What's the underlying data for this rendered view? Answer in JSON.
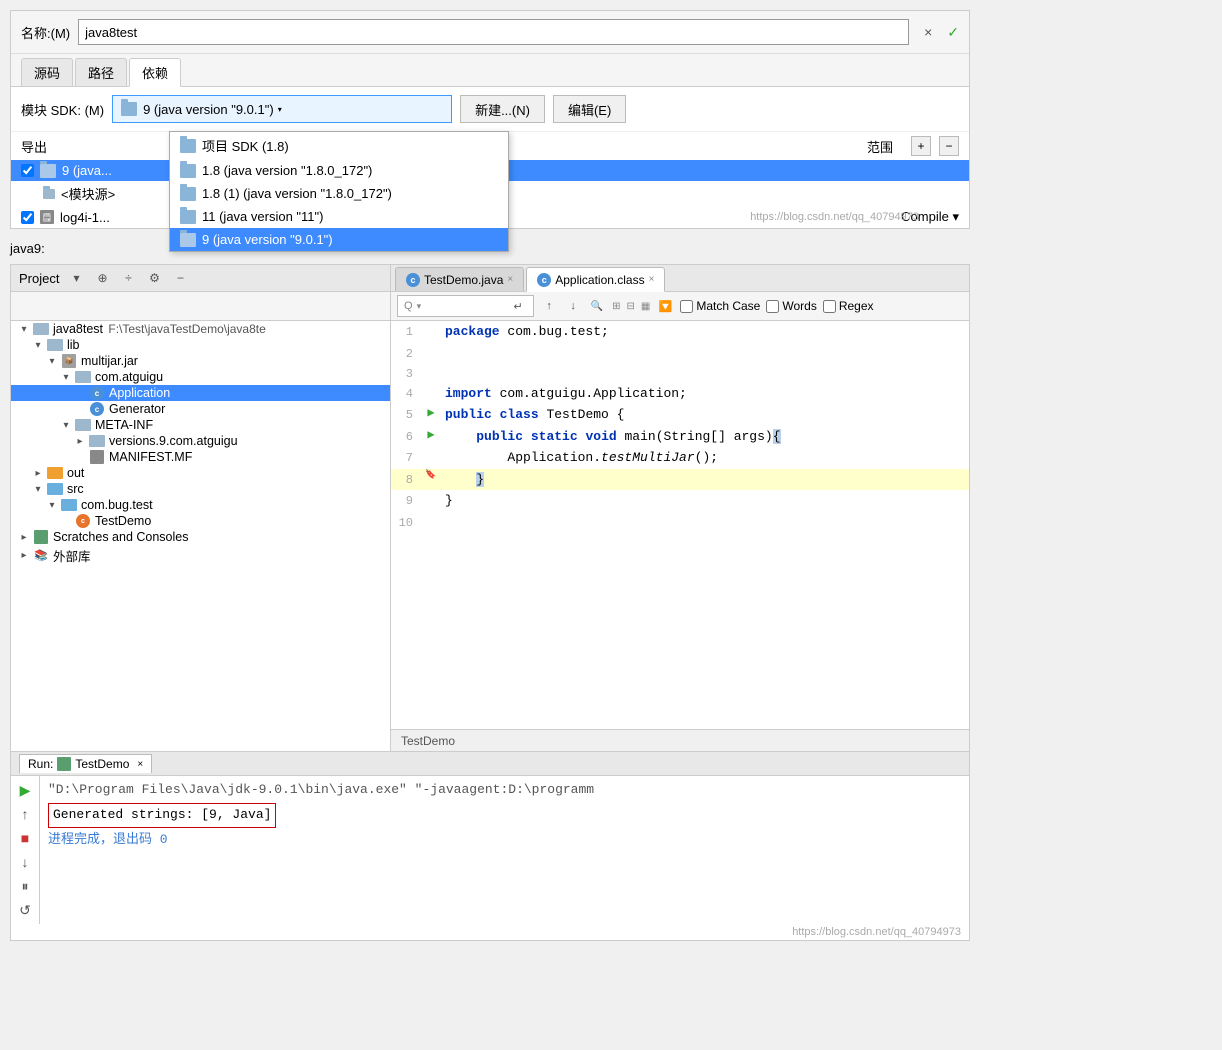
{
  "dialog": {
    "name_label": "名称:(M)",
    "name_value": "java8test",
    "close_btn": "×",
    "tabs": [
      "源码",
      "路径",
      "依赖"
    ],
    "active_tab": "依赖",
    "sdk_label": "模块 SDK: (M)",
    "sdk_selected": "9 (java version \"9.0.1\")",
    "new_btn": "新建...(N)",
    "edit_btn": "编辑(E)",
    "export_label": "导出",
    "scope_label": "范围",
    "plus_btn": "+",
    "minus_btn": "−",
    "dropdown_items": [
      {
        "label": "项目 SDK (1.8)",
        "selected": false
      },
      {
        "label": "1.8 (java version \"1.8.0_172\")",
        "selected": false
      },
      {
        "label": "1.8 (1) (java version \"1.8.0_172\")",
        "selected": false
      },
      {
        "label": "11 (java version \"11\")",
        "selected": false
      },
      {
        "label": "9 (java version \"9.0.1\")",
        "selected": true
      }
    ],
    "lib_rows": [
      {
        "icon": "folder",
        "name": "9 (java",
        "selected": false
      },
      {
        "icon": "module",
        "name": "<模块源>",
        "selected": false
      },
      {
        "name": "log4i-1...",
        "scope": "Compile",
        "selected": false
      }
    ],
    "watermark": "https://blog.csdn.net/qq_40794973"
  },
  "java9_label": "java9:",
  "ide": {
    "project_title": "Project",
    "header_icons": [
      "⊕",
      "÷",
      "⚙",
      "−"
    ],
    "editor_tabs": [
      {
        "label": "TestDemo.java",
        "active": false,
        "icon": "c"
      },
      {
        "label": "Application.class",
        "active": true,
        "icon": "c"
      }
    ],
    "search": {
      "placeholder": "",
      "match_case_label": "Match Case",
      "words_label": "Words",
      "regex_label": "Regex"
    },
    "project_tree": [
      {
        "indent": 0,
        "type": "arrow-expanded",
        "icon": "project",
        "label": "java8test",
        "path": "F:\\Test\\javaTestDemo\\java8te",
        "level": 0
      },
      {
        "indent": 1,
        "type": "arrow-expanded",
        "icon": "folder-gray",
        "label": "lib",
        "level": 1
      },
      {
        "indent": 2,
        "type": "arrow-expanded",
        "icon": "jar",
        "label": "multijar.jar",
        "level": 2
      },
      {
        "indent": 3,
        "type": "arrow-expanded",
        "icon": "folder-gray",
        "label": "com.atguigu",
        "level": 3
      },
      {
        "indent": 4,
        "type": "leaf",
        "icon": "class",
        "label": "Application",
        "level": 4
      },
      {
        "indent": 4,
        "type": "leaf",
        "icon": "class",
        "label": "Generator",
        "level": 4
      },
      {
        "indent": 3,
        "type": "arrow-expanded",
        "icon": "folder-gray",
        "label": "META-INF",
        "level": 3
      },
      {
        "indent": 4,
        "type": "arrow-collapsed",
        "icon": "folder-gray",
        "label": "versions.9.com.atguigu",
        "level": 4
      },
      {
        "indent": 4,
        "type": "leaf",
        "icon": "manifest",
        "label": "MANIFEST.MF",
        "level": 4
      },
      {
        "indent": 1,
        "type": "arrow-collapsed",
        "icon": "folder-orange",
        "label": "out",
        "level": 1
      },
      {
        "indent": 1,
        "type": "arrow-expanded",
        "icon": "folder-blue",
        "label": "src",
        "level": 1
      },
      {
        "indent": 2,
        "type": "arrow-expanded",
        "icon": "folder-blue",
        "label": "com.bug.test",
        "level": 2
      },
      {
        "indent": 3,
        "type": "leaf",
        "icon": "java",
        "label": "TestDemo",
        "level": 3
      },
      {
        "indent": 0,
        "type": "arrow-collapsed",
        "icon": "scratches",
        "label": "Scratches and Consoles",
        "level": 0
      },
      {
        "indent": 0,
        "type": "arrow-collapsed",
        "icon": "lib-icon",
        "label": "外部库",
        "level": 0
      }
    ],
    "code_lines": [
      {
        "num": 1,
        "content": "package com.bug.test;",
        "tokens": [
          {
            "type": "kw-blue",
            "text": "package"
          },
          {
            "type": "normal",
            "text": " com.bug.test;"
          }
        ]
      },
      {
        "num": 2,
        "content": ""
      },
      {
        "num": 3,
        "content": ""
      },
      {
        "num": 4,
        "content": "import com.atguigu.Application;",
        "tokens": [
          {
            "type": "kw-blue",
            "text": "import"
          },
          {
            "type": "normal",
            "text": " com.atguigu.Application;"
          }
        ]
      },
      {
        "num": 5,
        "content": "public class TestDemo {",
        "tokens": [
          {
            "type": "kw-blue",
            "text": "public"
          },
          {
            "type": "normal",
            "text": " "
          },
          {
            "type": "kw-blue",
            "text": "class"
          },
          {
            "type": "normal",
            "text": " TestDemo {"
          }
        ],
        "run_arrow": true
      },
      {
        "num": 6,
        "content": "    public static void main(String[] args){",
        "tokens": [
          {
            "type": "kw-blue",
            "text": "    public"
          },
          {
            "type": "normal",
            "text": " "
          },
          {
            "type": "kw-blue",
            "text": "static"
          },
          {
            "type": "normal",
            "text": " "
          },
          {
            "type": "kw-blue",
            "text": "void"
          },
          {
            "type": "normal",
            "text": " main(String[] args){"
          }
        ],
        "run_arrow": true,
        "has_bracket_highlight": true
      },
      {
        "num": 7,
        "content": "        Application.testMultiJar();",
        "tokens": [
          {
            "type": "normal",
            "text": "        Application."
          },
          {
            "type": "method",
            "text": "testMultiJar"
          },
          {
            "type": "normal",
            "text": "();"
          }
        ]
      },
      {
        "num": 8,
        "content": "    }",
        "tokens": [
          {
            "type": "normal",
            "text": "    }"
          }
        ],
        "highlighted": true
      },
      {
        "num": 9,
        "content": "}",
        "tokens": [
          {
            "type": "normal",
            "text": "}"
          }
        ]
      },
      {
        "num": 10,
        "content": ""
      }
    ],
    "editor_status": "TestDemo",
    "run": {
      "label": "Run:",
      "tab_label": "TestDemo",
      "output_line1": "\"D:\\Program Files\\Java\\jdk-9.0.1\\bin\\java.exe\" \"-javaagent:D:\\programm",
      "output_line2": "Generated strings: [9, Java]",
      "output_line3": "进程完成，退出码 0",
      "watermark": "https://blog.csdn.net/qq_40794973"
    }
  }
}
